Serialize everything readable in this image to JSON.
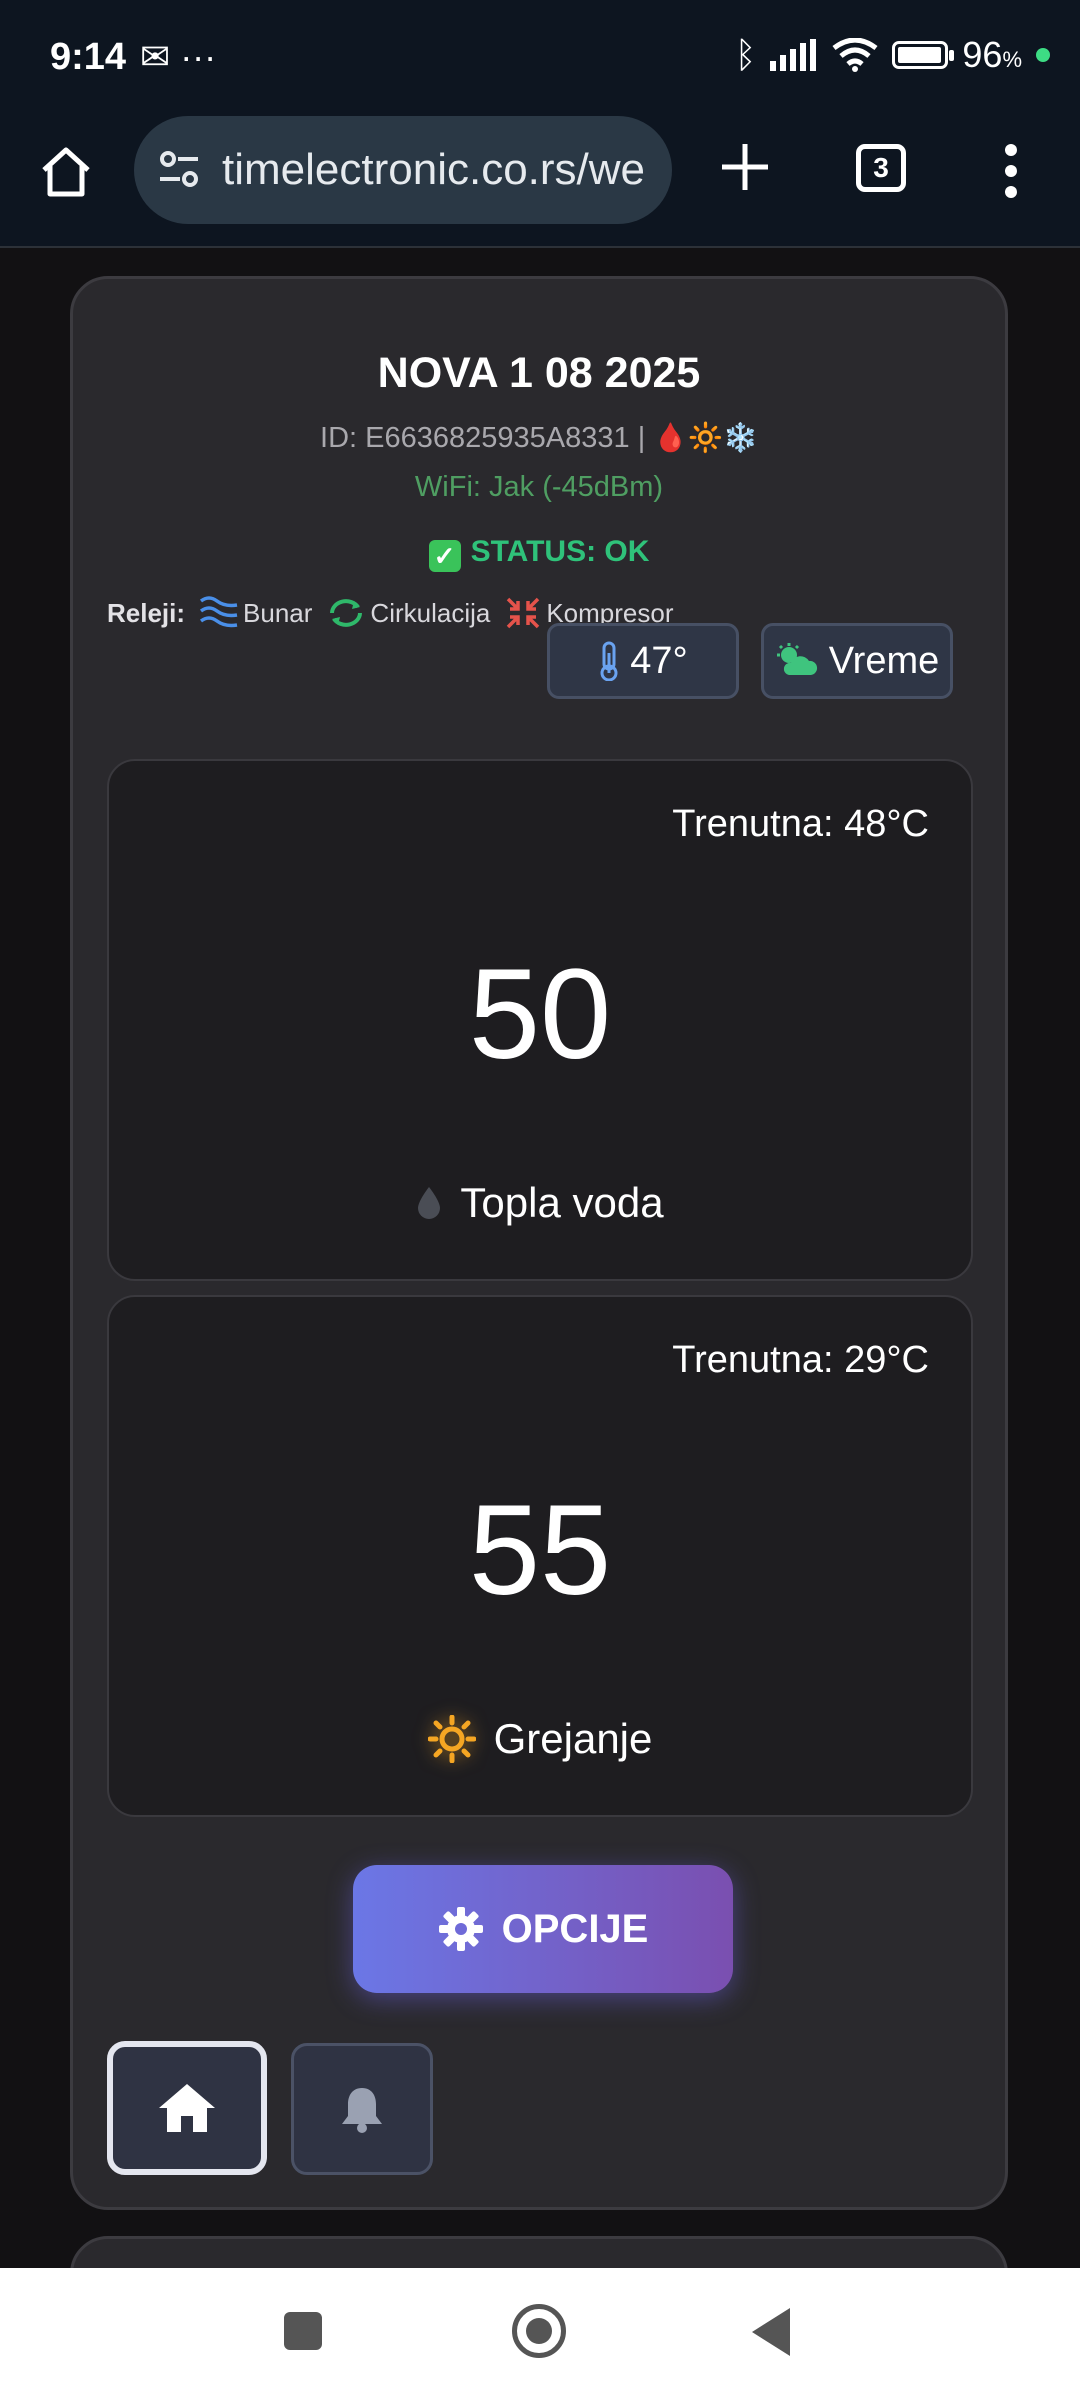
{
  "status_bar": {
    "time": "9:14",
    "left_icons": [
      "gmail-icon",
      "more-dots-icon"
    ],
    "battery": "96",
    "battery_level": 0.96,
    "battery_unit": "%"
  },
  "browser": {
    "url": "timelectronic.co.rs/we",
    "tab_count": "3"
  },
  "device": {
    "title": "NOVA 1 08 2025",
    "id_text": "ID: E6636825935A8331 |",
    "id_emojis": [
      "🩸",
      "🔆",
      "❄️"
    ],
    "wifi": "WiFi: Jak (-45dBm)",
    "status": "STATUS: OK",
    "relays_label": "Releji:",
    "relays": [
      {
        "name": "Bunar",
        "icon": "waves-icon",
        "color": "#4a8fe8"
      },
      {
        "name": "Cirkulacija",
        "icon": "recycle-icon",
        "color": "#2fb86a"
      },
      {
        "name": "Kompresor",
        "icon": "compress-icon",
        "color": "#e5534b"
      }
    ],
    "temp_button": "47°",
    "weather_button": "Vreme"
  },
  "panels": [
    {
      "current": "Trenutna: 48°C",
      "setpoint": "50",
      "mode": "Topla voda",
      "mode_icon": "water-drop-icon"
    },
    {
      "current": "Trenutna: 29°C",
      "setpoint": "55",
      "mode": "Grejanje",
      "mode_icon": "sun-icon"
    }
  ],
  "actions": {
    "options_label": "OPCIJE"
  },
  "colors": {
    "accent_gradient_start": "#6b77e6",
    "accent_gradient_end": "#7a4fb0",
    "status_ok": "#2fc27a",
    "wifi_text": "#4f9e62"
  }
}
